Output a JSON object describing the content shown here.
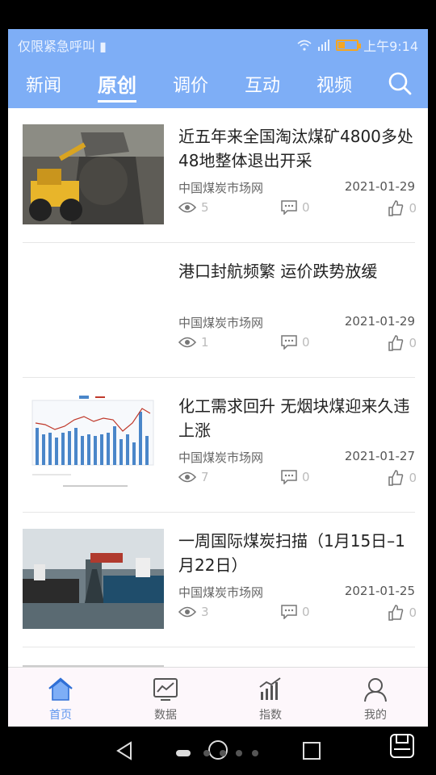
{
  "status_bar": {
    "left_text": "仅限紧急呼叫",
    "time": "上午9:14"
  },
  "top_nav": {
    "tabs": [
      "新闻",
      "原创",
      "调价",
      "互动",
      "视频"
    ],
    "active_tab": "原创"
  },
  "articles": [
    {
      "title": "近五年来全国淘汰煤矿4800多处48地整体退出开采",
      "source": "中国煤炭市场网",
      "date": "2021-01-29",
      "views": "5",
      "comments": "0",
      "likes": "0",
      "thumb": "loader-coal-photo"
    },
    {
      "title": "港口封航频繁 运价跌势放缓",
      "source": "中国煤炭市场网",
      "date": "2021-01-29",
      "views": "1",
      "comments": "0",
      "likes": "0",
      "thumb": "none"
    },
    {
      "title": "化工需求回升 无烟块煤迎来久违上涨",
      "source": "中国煤炭市场网",
      "date": "2021-01-27",
      "views": "7",
      "comments": "0",
      "likes": "0",
      "thumb": "bar-line-chart"
    },
    {
      "title": "一周国际煤炭扫描（1月15日–1月22日）",
      "source": "中国煤炭市场网",
      "date": "2021-01-25",
      "views": "3",
      "comments": "0",
      "likes": "0",
      "thumb": "port-ships-photo"
    }
  ],
  "bottom_tabs": [
    {
      "label": "首页",
      "icon": "home-icon",
      "active": true
    },
    {
      "label": "数据",
      "icon": "chart-monitor-icon",
      "active": false
    },
    {
      "label": "指数",
      "icon": "index-chart-icon",
      "active": false
    },
    {
      "label": "我的",
      "icon": "user-icon",
      "active": false
    }
  ],
  "colors": {
    "header_blue": "#7eaef6",
    "active_tab_blue": "#5b94ef",
    "battery_orange": "#f5a623"
  }
}
